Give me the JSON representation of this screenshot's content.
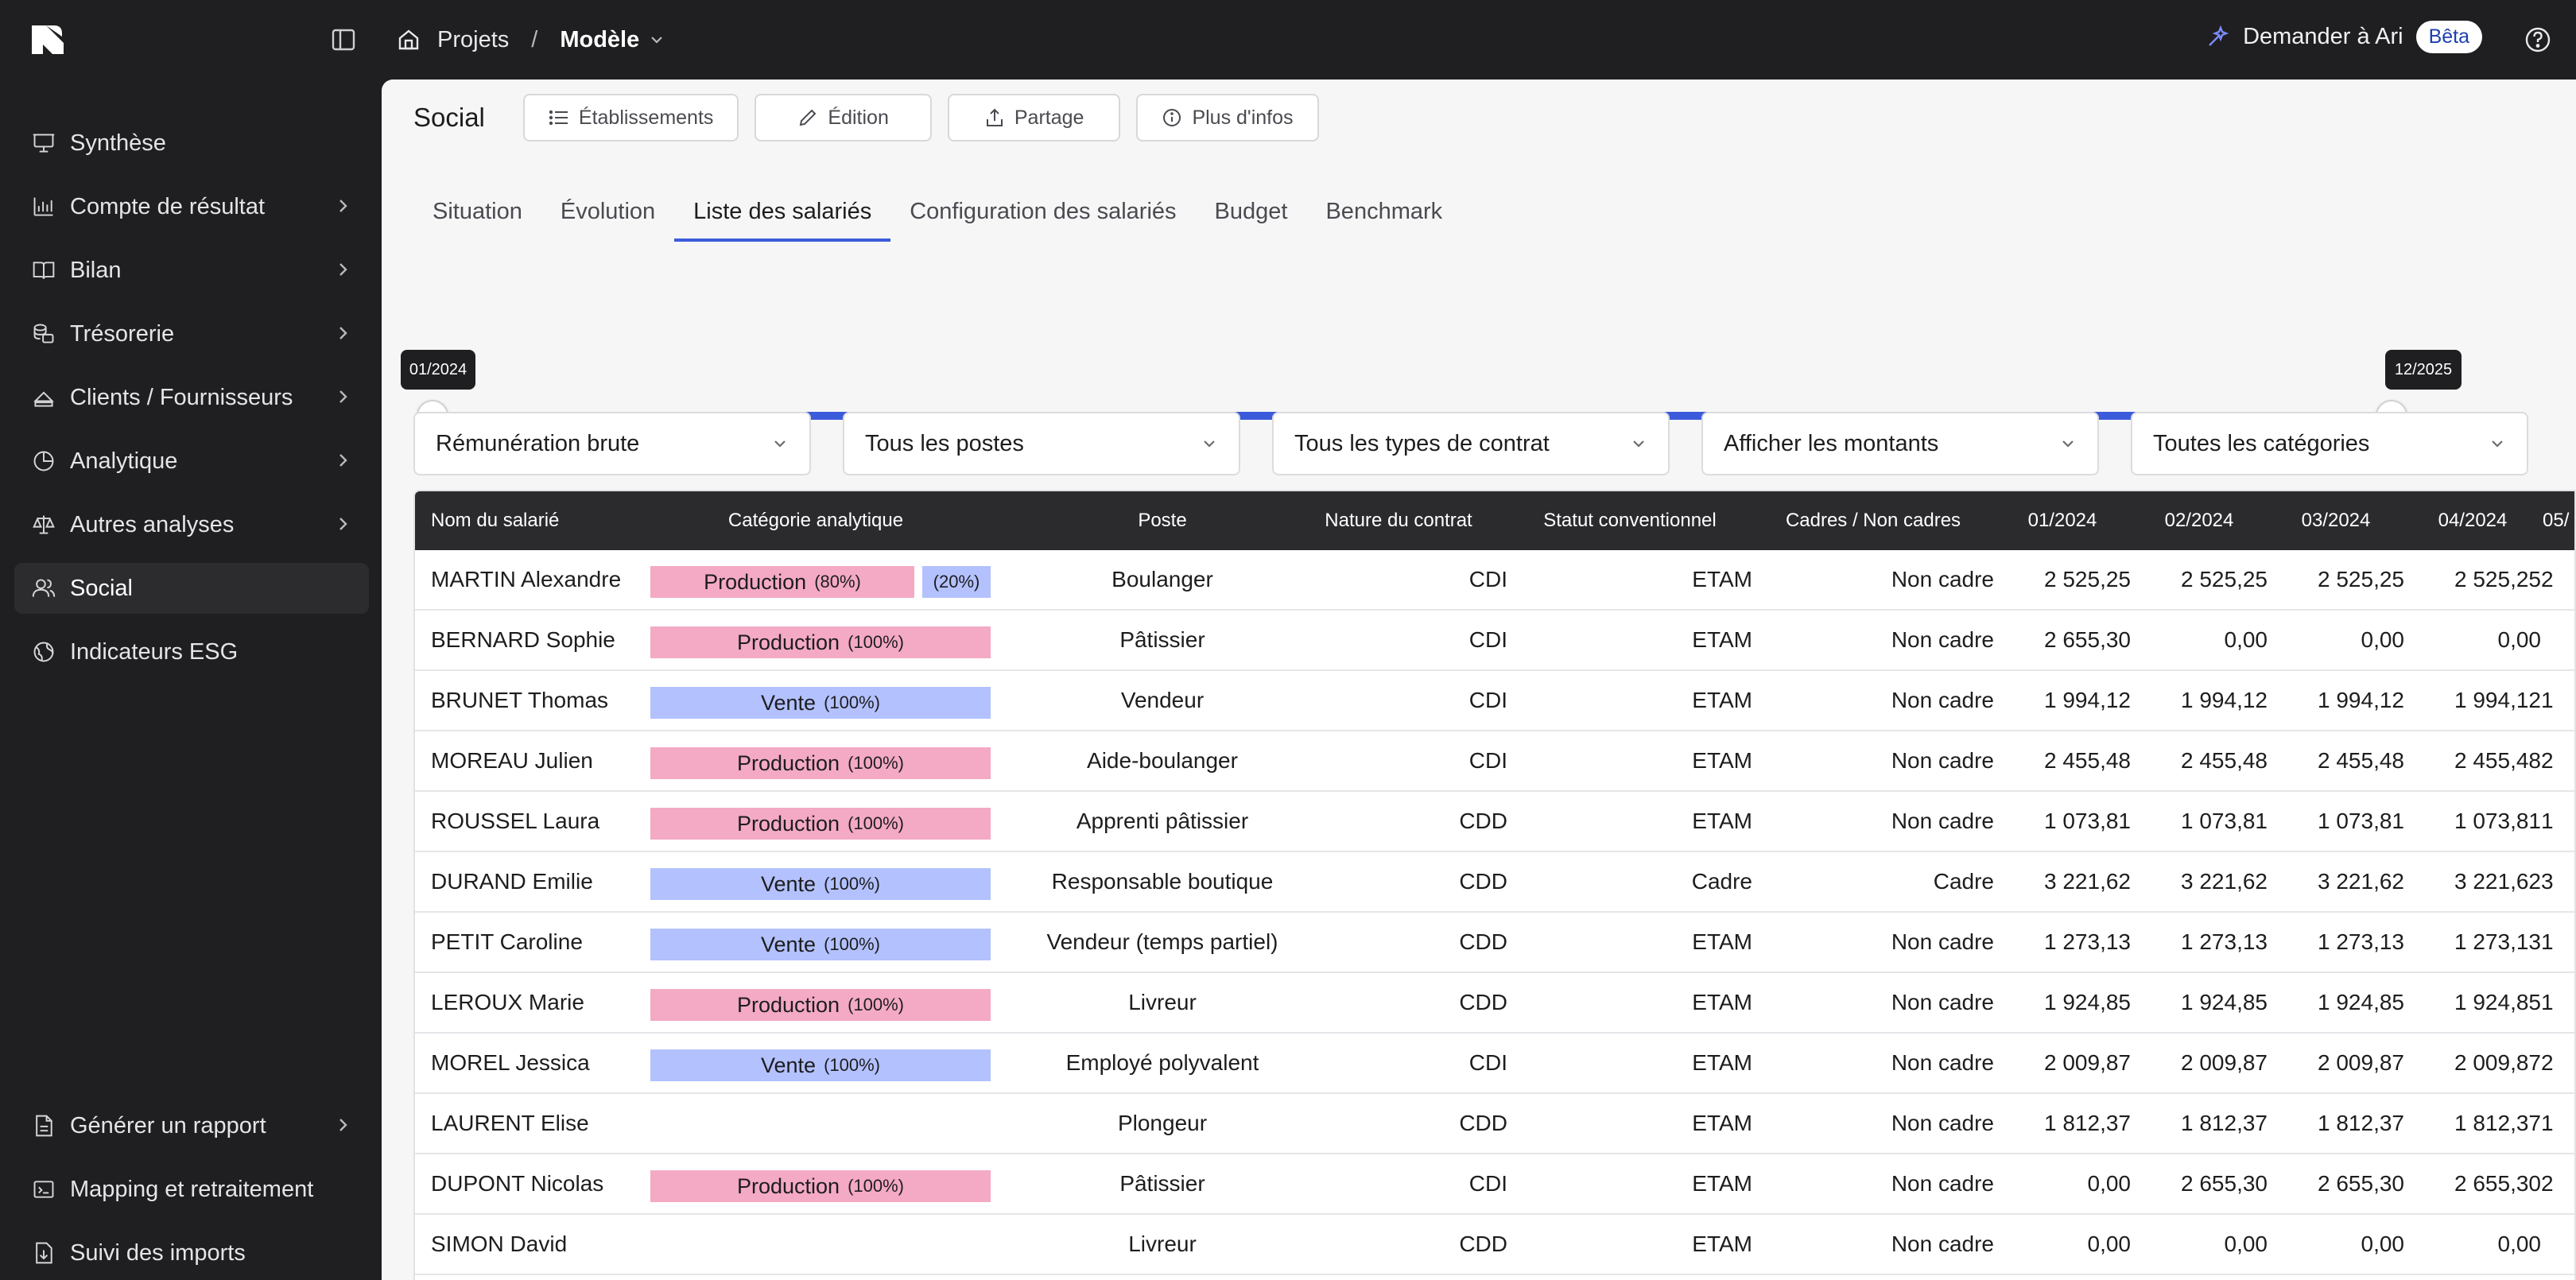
{
  "colors": {
    "dark": "#1f1f21",
    "accent": "#3b5bdb",
    "production": "#f4a9c4",
    "vente": "#b3c1ff"
  },
  "topbar": {
    "logo_icon": "brand-logo",
    "breadcrumb": {
      "projects": "Projets",
      "separator": "/",
      "current": "Modèle"
    },
    "ask_label": "Demander à Ari",
    "beta_badge": "Bêta"
  },
  "sidebar": {
    "items": [
      {
        "label": "Synthèse",
        "icon": "presentation-icon",
        "chevron": false,
        "active": false
      },
      {
        "label": "Compte de résultat",
        "icon": "bar-chart-icon",
        "chevron": true,
        "active": false
      },
      {
        "label": "Bilan",
        "icon": "book-icon",
        "chevron": true,
        "active": false
      },
      {
        "label": "Trésorerie",
        "icon": "coins-icon",
        "chevron": true,
        "active": false
      },
      {
        "label": "Clients / Fournisseurs",
        "icon": "shapes-icon",
        "chevron": true,
        "active": false
      },
      {
        "label": "Analytique",
        "icon": "pie-chart-icon",
        "chevron": true,
        "active": false
      },
      {
        "label": "Autres analyses",
        "icon": "scale-icon",
        "chevron": true,
        "active": false
      },
      {
        "label": "Social",
        "icon": "users-icon",
        "chevron": false,
        "active": true
      },
      {
        "label": "Indicateurs ESG",
        "icon": "globe-icon",
        "chevron": false,
        "active": false
      }
    ],
    "bottom_items": [
      {
        "label": "Générer un rapport",
        "icon": "file-icon",
        "chevron": true
      },
      {
        "label": "Mapping et retraitement",
        "icon": "mapping-icon",
        "chevron": false
      },
      {
        "label": "Suivi des imports",
        "icon": "import-icon",
        "chevron": false
      }
    ]
  },
  "header": {
    "title": "Social",
    "buttons": [
      "Établissements",
      "Édition",
      "Partage",
      "Plus d'infos"
    ]
  },
  "tabs": [
    "Situation",
    "Évolution",
    "Liste des salariés",
    "Configuration des salariés",
    "Budget",
    "Benchmark"
  ],
  "active_tab": "Liste des salariés",
  "range": {
    "start": "01/2024",
    "end": "12/2025"
  },
  "filters": [
    "Rémunération brute",
    "Tous les postes",
    "Tous les types de contrat",
    "Afficher les montants",
    "Toutes les catégories"
  ],
  "table": {
    "headers": [
      "Nom du salarié",
      "Catégorie analytique",
      "Poste",
      "Nature du contrat",
      "Statut conventionnel",
      "Cadres / Non cadres",
      "01/2024",
      "02/2024",
      "03/2024",
      "04/2024",
      "05/"
    ],
    "rows": [
      {
        "name": "MARTIN Alexandre",
        "cats": [
          {
            "label": "Production",
            "pct": "(80%)",
            "color": "pink",
            "share": 0.8
          },
          {
            "label": "",
            "pct": "(20%)",
            "color": "blue",
            "share": 0.2
          }
        ],
        "poste": "Boulanger",
        "contrat": "CDI",
        "statut": "ETAM",
        "cadre": "Non cadre",
        "m1": "2 525,25",
        "m2": "2 525,25",
        "m3": "2 525,25",
        "m4": "2 525,25",
        "m5": "2"
      },
      {
        "name": "BERNARD Sophie",
        "cats": [
          {
            "label": "Production",
            "pct": "(100%)",
            "color": "pink",
            "share": 1
          }
        ],
        "poste": "Pâtissier",
        "contrat": "CDI",
        "statut": "ETAM",
        "cadre": "Non cadre",
        "m1": "2 655,30",
        "m2": "0,00",
        "m3": "0,00",
        "m4": "0,00",
        "m5": ""
      },
      {
        "name": "BRUNET Thomas",
        "cats": [
          {
            "label": "Vente",
            "pct": "(100%)",
            "color": "blue",
            "share": 1
          }
        ],
        "poste": "Vendeur",
        "contrat": "CDI",
        "statut": "ETAM",
        "cadre": "Non cadre",
        "m1": "1 994,12",
        "m2": "1 994,12",
        "m3": "1 994,12",
        "m4": "1 994,12",
        "m5": "1"
      },
      {
        "name": "MOREAU Julien",
        "cats": [
          {
            "label": "Production",
            "pct": "(100%)",
            "color": "pink",
            "share": 1
          }
        ],
        "poste": "Aide-boulanger",
        "contrat": "CDI",
        "statut": "ETAM",
        "cadre": "Non cadre",
        "m1": "2 455,48",
        "m2": "2 455,48",
        "m3": "2 455,48",
        "m4": "2 455,48",
        "m5": "2"
      },
      {
        "name": "ROUSSEL Laura",
        "cats": [
          {
            "label": "Production",
            "pct": "(100%)",
            "color": "pink",
            "share": 1
          }
        ],
        "poste": "Apprenti pâtissier",
        "contrat": "CDD",
        "statut": "ETAM",
        "cadre": "Non cadre",
        "m1": "1 073,81",
        "m2": "1 073,81",
        "m3": "1 073,81",
        "m4": "1 073,81",
        "m5": "1"
      },
      {
        "name": "DURAND Emilie",
        "cats": [
          {
            "label": "Vente",
            "pct": "(100%)",
            "color": "blue",
            "share": 1
          }
        ],
        "poste": "Responsable boutique",
        "contrat": "CDD",
        "statut": "Cadre",
        "cadre": "Cadre",
        "m1": "3 221,62",
        "m2": "3 221,62",
        "m3": "3 221,62",
        "m4": "3 221,62",
        "m5": "3"
      },
      {
        "name": "PETIT Caroline",
        "cats": [
          {
            "label": "Vente",
            "pct": "(100%)",
            "color": "blue",
            "share": 1
          }
        ],
        "poste": "Vendeur (temps partiel)",
        "contrat": "CDD",
        "statut": "ETAM",
        "cadre": "Non cadre",
        "m1": "1 273,13",
        "m2": "1 273,13",
        "m3": "1 273,13",
        "m4": "1 273,13",
        "m5": "1"
      },
      {
        "name": "LEROUX Marie",
        "cats": [
          {
            "label": "Production",
            "pct": "(100%)",
            "color": "pink",
            "share": 1
          }
        ],
        "poste": "Livreur",
        "contrat": "CDD",
        "statut": "ETAM",
        "cadre": "Non cadre",
        "m1": "1 924,85",
        "m2": "1 924,85",
        "m3": "1 924,85",
        "m4": "1 924,85",
        "m5": "1"
      },
      {
        "name": "MOREL Jessica",
        "cats": [
          {
            "label": "Vente",
            "pct": "(100%)",
            "color": "blue",
            "share": 1
          }
        ],
        "poste": "Employé polyvalent",
        "contrat": "CDI",
        "statut": "ETAM",
        "cadre": "Non cadre",
        "m1": "2 009,87",
        "m2": "2 009,87",
        "m3": "2 009,87",
        "m4": "2 009,87",
        "m5": "2"
      },
      {
        "name": "LAURENT Elise",
        "cats": [],
        "poste": "Plongeur",
        "contrat": "CDD",
        "statut": "ETAM",
        "cadre": "Non cadre",
        "m1": "1 812,37",
        "m2": "1 812,37",
        "m3": "1 812,37",
        "m4": "1 812,37",
        "m5": "1"
      },
      {
        "name": "DUPONT Nicolas",
        "cats": [
          {
            "label": "Production",
            "pct": "(100%)",
            "color": "pink",
            "share": 1
          }
        ],
        "poste": "Pâtissier",
        "contrat": "CDI",
        "statut": "ETAM",
        "cadre": "Non cadre",
        "m1": "0,00",
        "m2": "2 655,30",
        "m3": "2 655,30",
        "m4": "2 655,30",
        "m5": "2"
      },
      {
        "name": "SIMON David",
        "cats": [],
        "poste": "Livreur",
        "contrat": "CDD",
        "statut": "ETAM",
        "cadre": "Non cadre",
        "m1": "0,00",
        "m2": "0,00",
        "m3": "0,00",
        "m4": "0,00",
        "m5": ""
      }
    ]
  }
}
